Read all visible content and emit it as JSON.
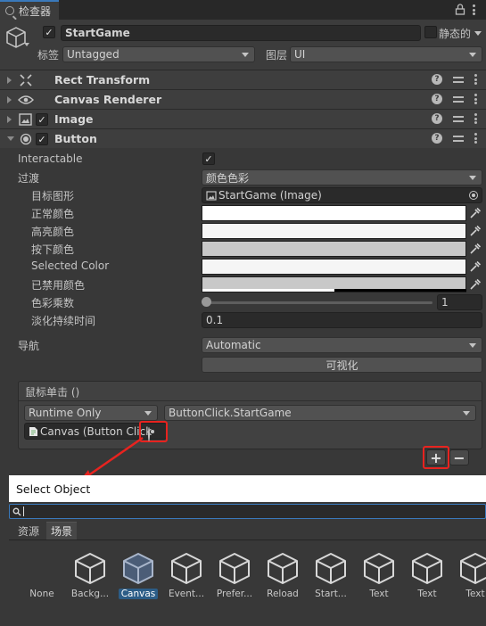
{
  "tab": {
    "title": "检查器"
  },
  "object": {
    "name": "StartGame",
    "active": true,
    "static_label": "静态的",
    "tag_label": "标签",
    "tag_value": "Untagged",
    "layer_label": "图层",
    "layer_value": "UI"
  },
  "components": [
    {
      "name": "Rect Transform",
      "icon": "rect-transform-icon",
      "checkbox": false
    },
    {
      "name": "Canvas Renderer",
      "icon": "eye-icon",
      "checkbox": false
    },
    {
      "name": "Image",
      "icon": "image-icon",
      "checkbox": true
    },
    {
      "name": "Button",
      "icon": "button-icon",
      "checkbox": true
    }
  ],
  "button": {
    "interactable_label": "Interactable",
    "transition_label": "过渡",
    "transition_value": "颜色色彩",
    "target_label": "目标图形",
    "target_value": "StartGame (Image)",
    "normal_label": "正常颜色",
    "highlight_label": "高亮颜色",
    "pressed_label": "按下颜色",
    "selected_label": "Selected Color",
    "disabled_label": "已禁用颜色",
    "multiplier_label": "色彩乘数",
    "multiplier_value": "1",
    "fade_label": "淡化持续时间",
    "fade_value": "0.1",
    "nav_label": "导航",
    "nav_value": "Automatic",
    "visualize_label": "可视化"
  },
  "event": {
    "title": "鼠标单击 ()",
    "runtime_value": "Runtime Only",
    "function_value": "ButtonClick.StartGame",
    "object_value": "Canvas (Button Click",
    "add_label": "+",
    "remove_label": "−"
  },
  "modal": {
    "title": "Select Object",
    "tabs": [
      "资源",
      "场景"
    ],
    "items": [
      "None",
      "Backg...",
      "Canvas",
      "Event...",
      "Prefer...",
      "Reload",
      "Start...",
      "Text",
      "Text",
      "Text"
    ],
    "selected_index": 2
  },
  "colors": {
    "accent": "#3a79bb",
    "highlight_red": "#e8231f",
    "selection": "#2c5d87"
  }
}
